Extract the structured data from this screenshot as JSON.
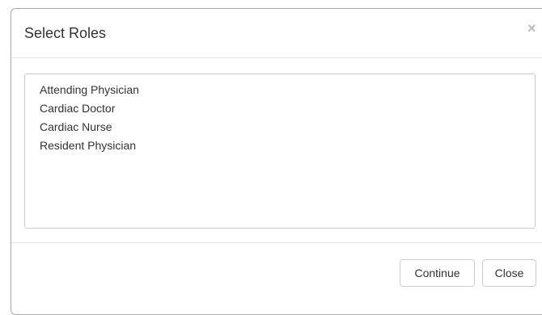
{
  "dialog": {
    "title": "Select Roles",
    "close_glyph": "×",
    "close_icon": "close-icon"
  },
  "roles": [
    "Attending Physician",
    "Cardiac Doctor",
    "Cardiac Nurse",
    "Resident Physician"
  ],
  "footer": {
    "continue_label": "Continue",
    "close_label": "Close"
  }
}
